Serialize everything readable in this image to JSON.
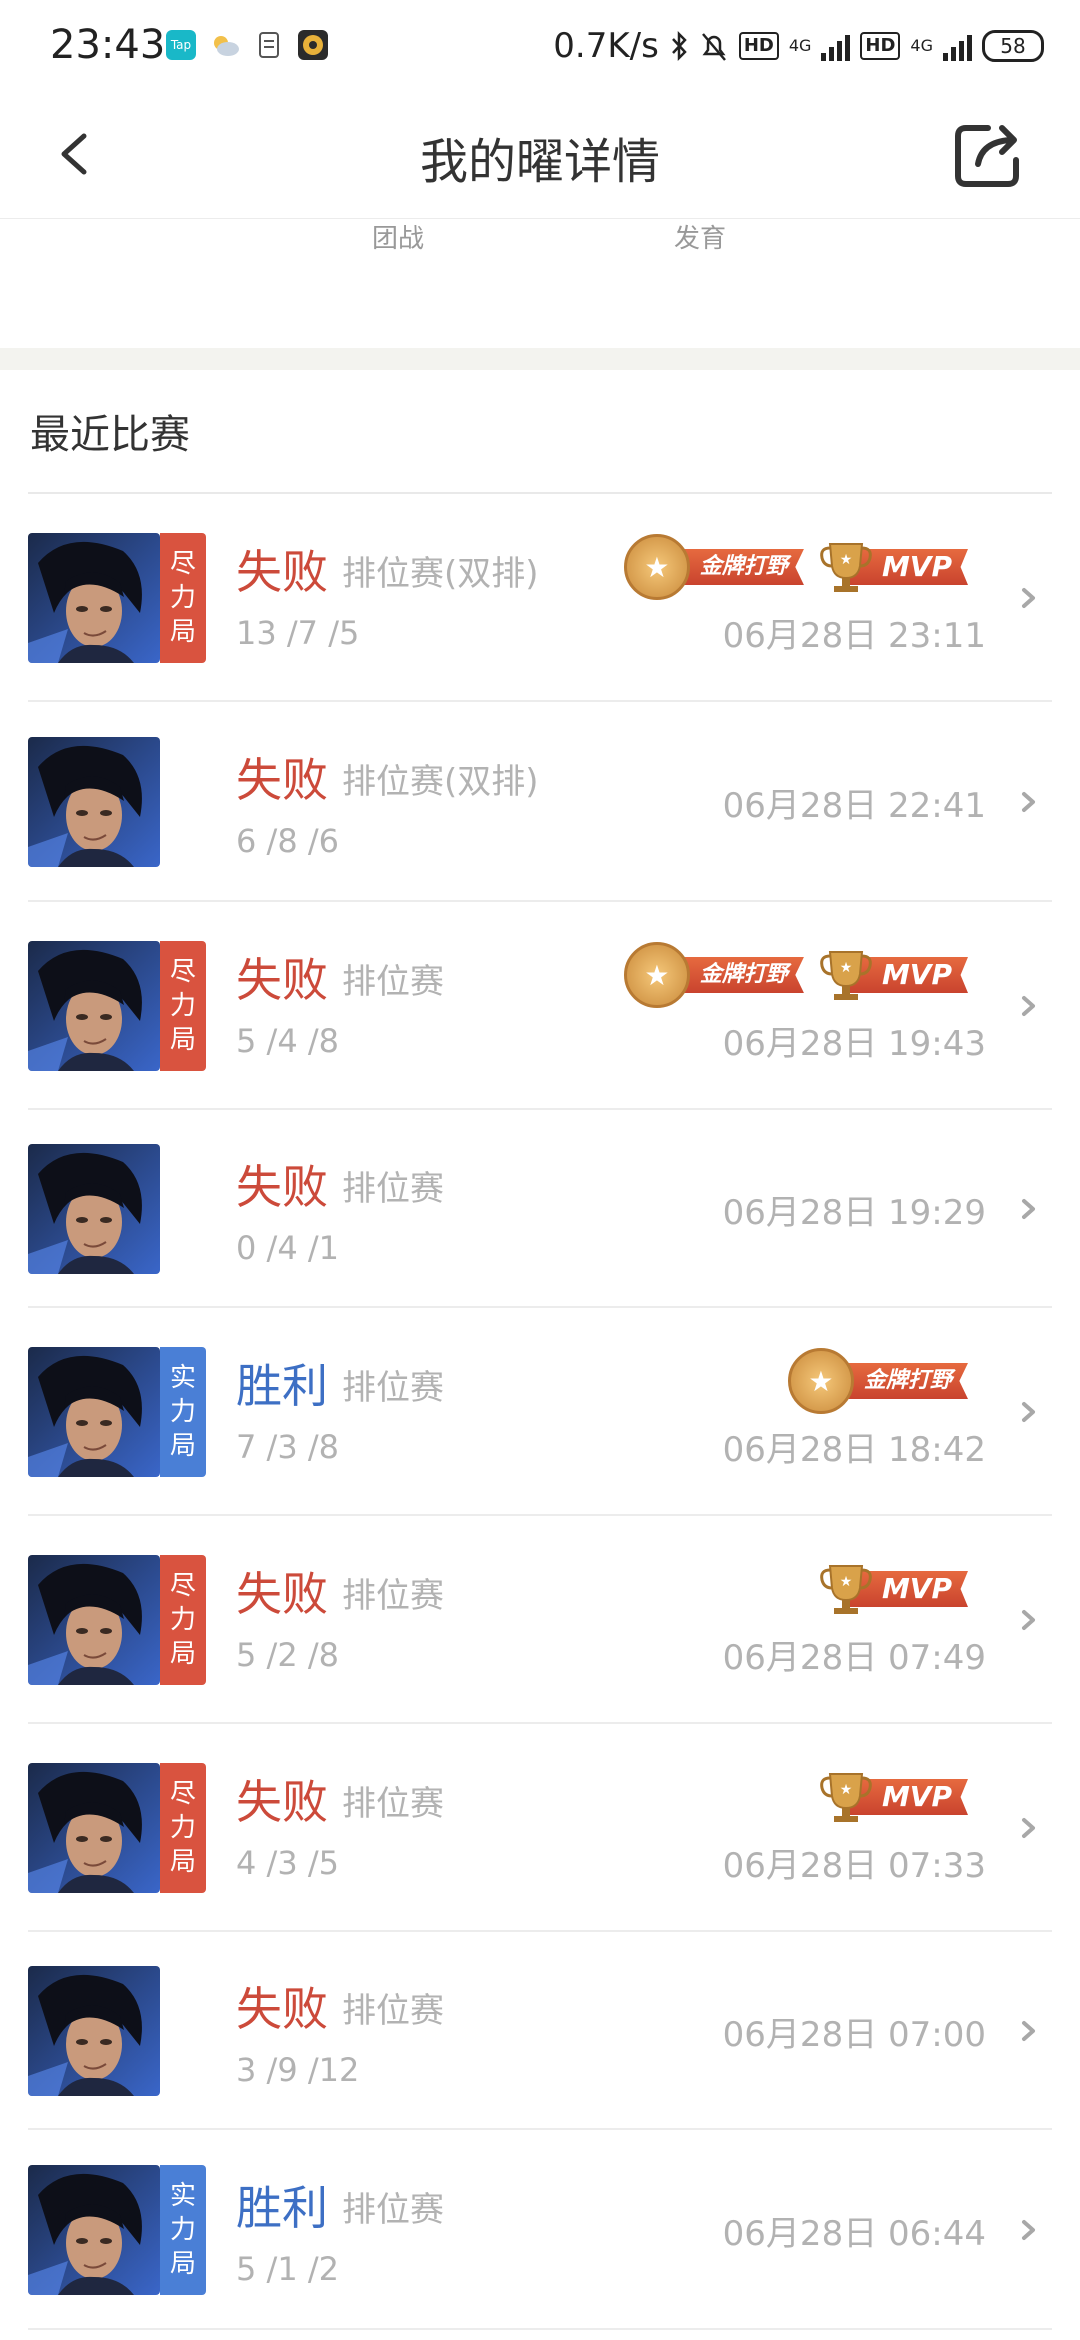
{
  "status_bar": {
    "time": "23:43",
    "left_icons": [
      "taptap-icon",
      "weather-icon",
      "notes-icon",
      "game-icon"
    ],
    "speed": "0.7K/s",
    "hd1": "HD",
    "hd2": "HD",
    "net1": "4G",
    "net2": "4G",
    "battery": "58"
  },
  "nav": {
    "title": "我的曜详情"
  },
  "stats_partial": {
    "label_left": "团战",
    "label_right": "发育"
  },
  "section": {
    "title": "最近比赛"
  },
  "badge_text": {
    "gold_jungle": "金牌打野",
    "mvp": "MVP"
  },
  "matches": [
    {
      "result": "失败",
      "mode": "排位赛(双排)",
      "kda": "13 /7 /5",
      "time": "06月28日 23:11",
      "tag": [
        "尽",
        "力",
        "局"
      ],
      "win": false,
      "badges": [
        "gold_jungle",
        "mvp"
      ]
    },
    {
      "result": "失败",
      "mode": "排位赛(双排)",
      "kda": "6 /8 /6",
      "time": "06月28日 22:41",
      "tag": null,
      "win": false,
      "badges": []
    },
    {
      "result": "失败",
      "mode": "排位赛",
      "kda": "5 /4 /8",
      "time": "06月28日 19:43",
      "tag": [
        "尽",
        "力",
        "局"
      ],
      "win": false,
      "badges": [
        "gold_jungle",
        "mvp"
      ]
    },
    {
      "result": "失败",
      "mode": "排位赛",
      "kda": "0 /4 /1",
      "time": "06月28日 19:29",
      "tag": null,
      "win": false,
      "badges": []
    },
    {
      "result": "胜利",
      "mode": "排位赛",
      "kda": "7 /3 /8",
      "time": "06月28日 18:42",
      "tag": [
        "实",
        "力",
        "局"
      ],
      "win": true,
      "badges": [
        "gold_jungle"
      ]
    },
    {
      "result": "失败",
      "mode": "排位赛",
      "kda": "5 /2 /8",
      "time": "06月28日 07:49",
      "tag": [
        "尽",
        "力",
        "局"
      ],
      "win": false,
      "badges": [
        "mvp"
      ]
    },
    {
      "result": "失败",
      "mode": "排位赛",
      "kda": "4 /3 /5",
      "time": "06月28日 07:33",
      "tag": [
        "尽",
        "力",
        "局"
      ],
      "win": false,
      "badges": [
        "mvp"
      ]
    },
    {
      "result": "失败",
      "mode": "排位赛",
      "kda": "3 /9 /12",
      "time": "06月28日 07:00",
      "tag": null,
      "win": false,
      "badges": []
    },
    {
      "result": "胜利",
      "mode": "排位赛",
      "kda": "5 /1 /2",
      "time": "06月28日 06:44",
      "tag": [
        "实",
        "力",
        "局"
      ],
      "win": true,
      "badges": []
    }
  ]
}
